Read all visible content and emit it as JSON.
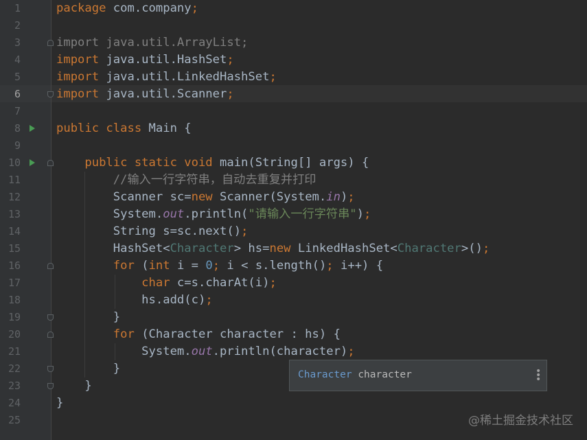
{
  "editor": {
    "current_line": 6,
    "lines": [
      {
        "n": "1",
        "tokens": [
          {
            "t": "package ",
            "c": "kw"
          },
          {
            "t": "com.company",
            "c": ""
          },
          {
            "t": ";",
            "c": "kw"
          }
        ]
      },
      {
        "n": "2",
        "tokens": []
      },
      {
        "n": "3",
        "tokens": [
          {
            "t": "import java.util.ArrayList;",
            "c": "imp"
          }
        ]
      },
      {
        "n": "4",
        "tokens": [
          {
            "t": "import ",
            "c": "kw"
          },
          {
            "t": "java.util.HashSet",
            "c": ""
          },
          {
            "t": ";",
            "c": "kw"
          }
        ]
      },
      {
        "n": "5",
        "tokens": [
          {
            "t": "import ",
            "c": "kw"
          },
          {
            "t": "java.util.LinkedHashSet",
            "c": ""
          },
          {
            "t": ";",
            "c": "kw"
          }
        ]
      },
      {
        "n": "6",
        "tokens": [
          {
            "t": "import ",
            "c": "kw"
          },
          {
            "t": "java.util.Scanner",
            "c": ""
          },
          {
            "t": ";",
            "c": "kw"
          }
        ]
      },
      {
        "n": "7",
        "tokens": []
      },
      {
        "n": "8",
        "tokens": [
          {
            "t": "public class ",
            "c": "kw"
          },
          {
            "t": "Main {",
            "c": ""
          }
        ]
      },
      {
        "n": "9",
        "tokens": []
      },
      {
        "n": "10",
        "tokens": [
          {
            "t": "    public static void ",
            "c": "kw"
          },
          {
            "t": "main(String[] args) {",
            "c": ""
          }
        ]
      },
      {
        "n": "11",
        "tokens": [
          {
            "t": "        //输入一行字符串，自动去重复并打印",
            "c": "cmt"
          }
        ]
      },
      {
        "n": "12",
        "tokens": [
          {
            "t": "        Scanner sc=",
            "c": ""
          },
          {
            "t": "new ",
            "c": "kw"
          },
          {
            "t": "Scanner(System.",
            "c": ""
          },
          {
            "t": "in",
            "c": "ital"
          },
          {
            "t": ")",
            "c": ""
          },
          {
            "t": ";",
            "c": "kw"
          }
        ]
      },
      {
        "n": "13",
        "tokens": [
          {
            "t": "        System.",
            "c": ""
          },
          {
            "t": "out",
            "c": "ital"
          },
          {
            "t": ".println(",
            "c": ""
          },
          {
            "t": "\"请输入一行字符串\"",
            "c": "str"
          },
          {
            "t": ")",
            "c": ""
          },
          {
            "t": ";",
            "c": "kw"
          }
        ]
      },
      {
        "n": "14",
        "tokens": [
          {
            "t": "        String s=sc.next()",
            "c": ""
          },
          {
            "t": ";",
            "c": "kw"
          }
        ]
      },
      {
        "n": "15",
        "tokens": [
          {
            "t": "        HashSet<",
            "c": ""
          },
          {
            "t": "Character",
            "c": "gen"
          },
          {
            "t": "> hs=",
            "c": ""
          },
          {
            "t": "new ",
            "c": "kw"
          },
          {
            "t": "LinkedHashSet<",
            "c": ""
          },
          {
            "t": "Character",
            "c": "gen"
          },
          {
            "t": ">()",
            "c": ""
          },
          {
            "t": ";",
            "c": "kw"
          }
        ]
      },
      {
        "n": "16",
        "tokens": [
          {
            "t": "        for ",
            "c": "kw"
          },
          {
            "t": "(",
            "c": ""
          },
          {
            "t": "int ",
            "c": "kw"
          },
          {
            "t": "i = ",
            "c": ""
          },
          {
            "t": "0",
            "c": "num"
          },
          {
            "t": "; ",
            "c": "kw"
          },
          {
            "t": "i < s.length()",
            "c": ""
          },
          {
            "t": "; ",
            "c": "kw"
          },
          {
            "t": "i++) {",
            "c": ""
          }
        ]
      },
      {
        "n": "17",
        "tokens": [
          {
            "t": "            char ",
            "c": "kw"
          },
          {
            "t": "c=s.charAt(i)",
            "c": ""
          },
          {
            "t": ";",
            "c": "kw"
          }
        ]
      },
      {
        "n": "18",
        "tokens": [
          {
            "t": "            hs.add(c)",
            "c": ""
          },
          {
            "t": ";",
            "c": "kw"
          }
        ]
      },
      {
        "n": "19",
        "tokens": [
          {
            "t": "        }",
            "c": ""
          }
        ]
      },
      {
        "n": "20",
        "tokens": [
          {
            "t": "        for ",
            "c": "kw"
          },
          {
            "t": "(Character character : hs) {",
            "c": ""
          }
        ]
      },
      {
        "n": "21",
        "tokens": [
          {
            "t": "            System.",
            "c": ""
          },
          {
            "t": "out",
            "c": "ital"
          },
          {
            "t": ".println(character)",
            "c": ""
          },
          {
            "t": ";",
            "c": "kw"
          }
        ]
      },
      {
        "n": "22",
        "tokens": [
          {
            "t": "        }",
            "c": ""
          }
        ]
      },
      {
        "n": "23",
        "tokens": [
          {
            "t": "    }",
            "c": ""
          }
        ]
      },
      {
        "n": "24",
        "tokens": [
          {
            "t": "}",
            "c": ""
          }
        ]
      },
      {
        "n": "25",
        "tokens": []
      }
    ],
    "run_icon_lines": [
      8,
      10
    ],
    "fold_start_lines": [
      3,
      10,
      16,
      20
    ],
    "fold_end_lines": [
      6,
      19,
      22,
      23
    ]
  },
  "tooltip": {
    "type": "Character",
    "name": "character",
    "menu_icon": "vertical-ellipsis-icon"
  },
  "watermark": "@稀土掘金技术社区",
  "colors": {
    "background": "#2b2b2b",
    "gutter": "#313335",
    "keyword": "#cc7832",
    "string": "#6a8759",
    "number": "#6897bb",
    "comment": "#808080",
    "static_field": "#9876aa",
    "default_text": "#a9b7c6",
    "run_icon": "#499c54"
  }
}
